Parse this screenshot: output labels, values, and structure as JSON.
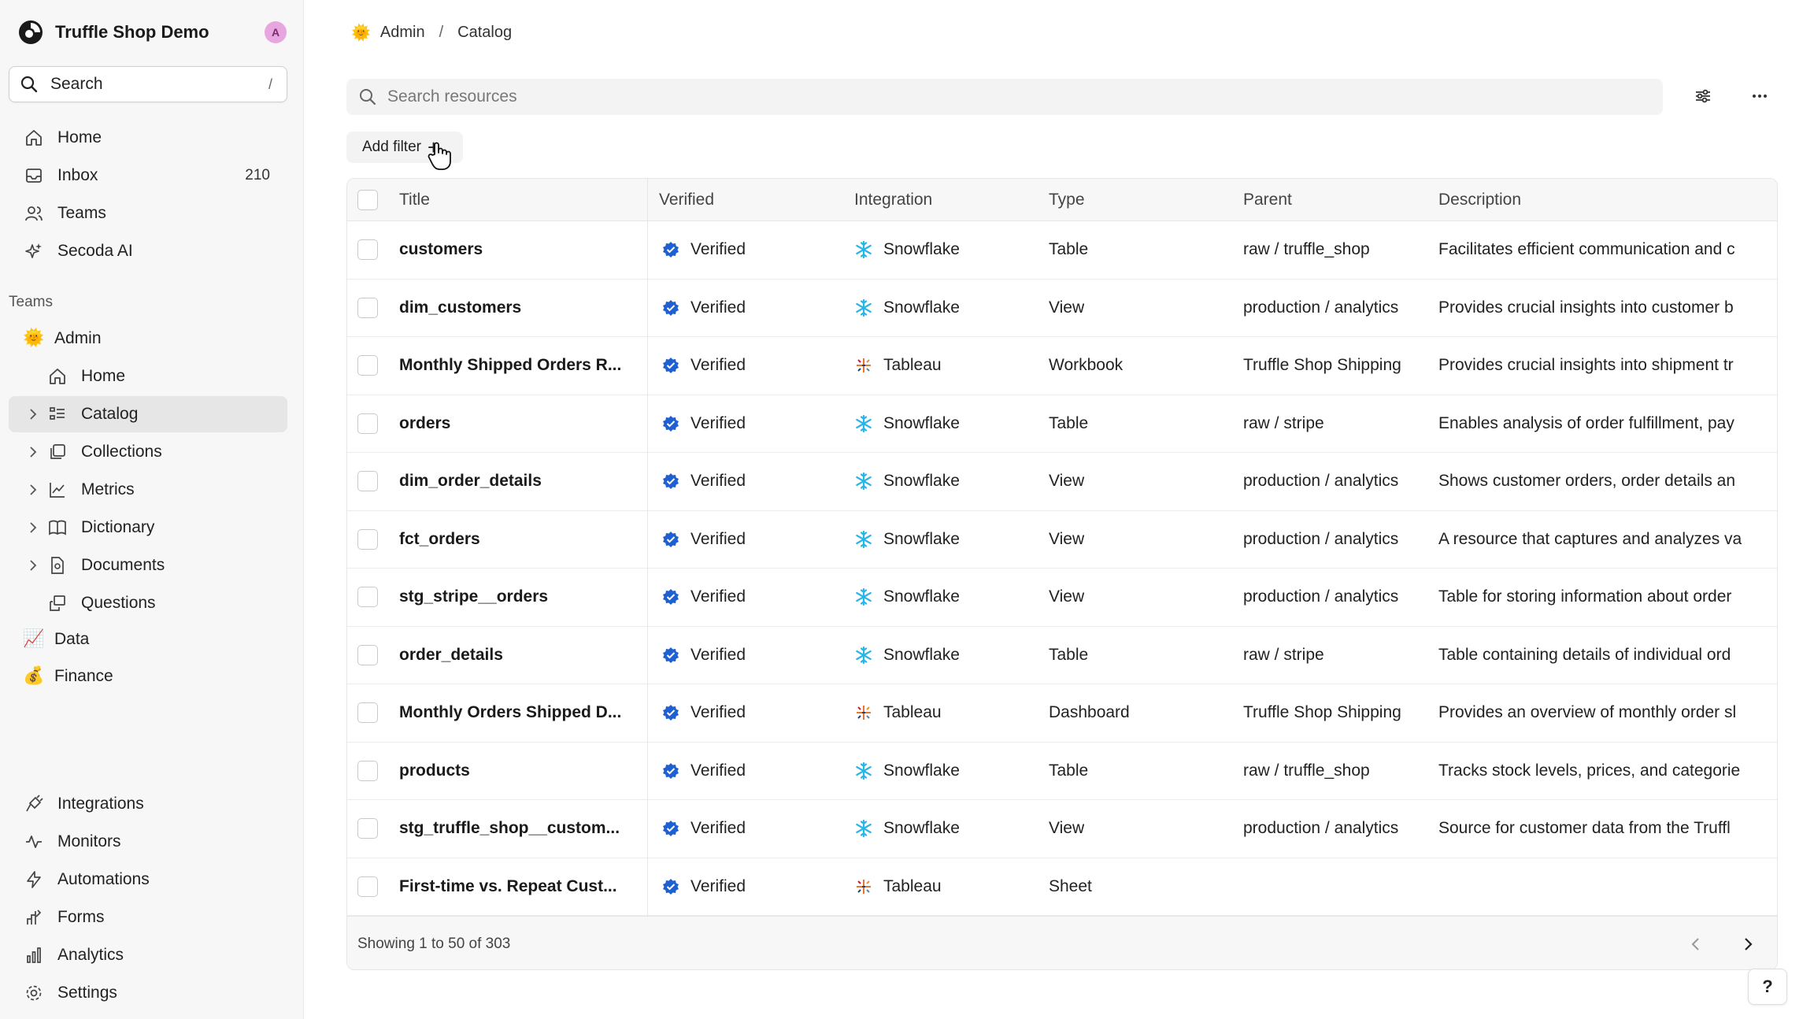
{
  "workspace": {
    "name": "Truffle Shop Demo",
    "avatar_initial": "A"
  },
  "sidebar": {
    "search_label": "Search",
    "search_shortcut": "/",
    "main_items": [
      {
        "label": "Home",
        "icon": "home-icon"
      },
      {
        "label": "Inbox",
        "icon": "inbox-icon",
        "count": "210"
      },
      {
        "label": "Teams",
        "icon": "teams-icon"
      },
      {
        "label": "Secoda AI",
        "icon": "sparkle-icon"
      }
    ],
    "teams_heading": "Teams",
    "team_admin": {
      "label": "Admin",
      "emoji": "🌞"
    },
    "admin_items": [
      {
        "label": "Home",
        "icon": "home-icon"
      },
      {
        "label": "Catalog",
        "icon": "catalog-icon",
        "active": true
      },
      {
        "label": "Collections",
        "icon": "collections-icon"
      },
      {
        "label": "Metrics",
        "icon": "metrics-icon"
      },
      {
        "label": "Dictionary",
        "icon": "dictionary-icon"
      },
      {
        "label": "Documents",
        "icon": "documents-icon"
      },
      {
        "label": "Questions",
        "icon": "questions-icon"
      }
    ],
    "other_teams": [
      {
        "label": "Data",
        "emoji": "📈"
      },
      {
        "label": "Finance",
        "emoji": "💰"
      }
    ],
    "bottom_items": [
      {
        "label": "Integrations",
        "icon": "integrations-icon"
      },
      {
        "label": "Monitors",
        "icon": "monitors-icon"
      },
      {
        "label": "Automations",
        "icon": "automations-icon"
      },
      {
        "label": "Forms",
        "icon": "forms-icon"
      },
      {
        "label": "Analytics",
        "icon": "analytics-icon"
      },
      {
        "label": "Settings",
        "icon": "settings-icon"
      }
    ]
  },
  "breadcrumb": {
    "team": "Admin",
    "separator": "/",
    "page": "Catalog"
  },
  "search": {
    "placeholder": "Search resources"
  },
  "add_filter_label": "Add filter",
  "table": {
    "headers": [
      "Title",
      "Verified",
      "Integration",
      "Type",
      "Parent",
      "Description"
    ],
    "rows": [
      {
        "title": "customers",
        "verified": "Verified",
        "integration": "Snowflake",
        "type": "Table",
        "parent": "raw / truffle_shop",
        "description": "Facilitates efficient communication and c"
      },
      {
        "title": "dim_customers",
        "verified": "Verified",
        "integration": "Snowflake",
        "type": "View",
        "parent": "production / analytics",
        "description": "Provides crucial insights into customer b"
      },
      {
        "title": "Monthly Shipped Orders R...",
        "verified": "Verified",
        "integration": "Tableau",
        "type": "Workbook",
        "parent": "Truffle Shop Shipping",
        "description": "Provides crucial insights into shipment tr"
      },
      {
        "title": "orders",
        "verified": "Verified",
        "integration": "Snowflake",
        "type": "Table",
        "parent": "raw / stripe",
        "description": "Enables analysis of order fulfillment, pay"
      },
      {
        "title": "dim_order_details",
        "verified": "Verified",
        "integration": "Snowflake",
        "type": "View",
        "parent": "production / analytics",
        "description": "Shows customer orders, order details an"
      },
      {
        "title": "fct_orders",
        "verified": "Verified",
        "integration": "Snowflake",
        "type": "View",
        "parent": "production / analytics",
        "description": "A resource that captures and analyzes va"
      },
      {
        "title": "stg_stripe__orders",
        "verified": "Verified",
        "integration": "Snowflake",
        "type": "View",
        "parent": "production / analytics",
        "description": "Table for storing information about order"
      },
      {
        "title": "order_details",
        "verified": "Verified",
        "integration": "Snowflake",
        "type": "Table",
        "parent": "raw / stripe",
        "description": "Table containing details of individual ord"
      },
      {
        "title": "Monthly Orders Shipped D...",
        "verified": "Verified",
        "integration": "Tableau",
        "type": "Dashboard",
        "parent": "Truffle Shop Shipping",
        "description": "Provides an overview of monthly order sl"
      },
      {
        "title": "products",
        "verified": "Verified",
        "integration": "Snowflake",
        "type": "Table",
        "parent": "raw / truffle_shop",
        "description": "Tracks stock levels, prices, and categorie"
      },
      {
        "title": "stg_truffle_shop__custom...",
        "verified": "Verified",
        "integration": "Snowflake",
        "type": "View",
        "parent": "production / analytics",
        "description": "Source for customer data from the Truffl"
      },
      {
        "title": "First-time vs. Repeat Cust...",
        "verified": "Verified",
        "integration": "Tableau",
        "type": "Sheet",
        "parent": "",
        "description": ""
      }
    ],
    "footer": "Showing 1 to 50 of 303"
  },
  "help_label": "?",
  "colors": {
    "verified": "#1e5fd1",
    "snowflake": "#29b5e8",
    "active_nav": "#e6e6e6",
    "avatar": "#e8a6e0"
  }
}
